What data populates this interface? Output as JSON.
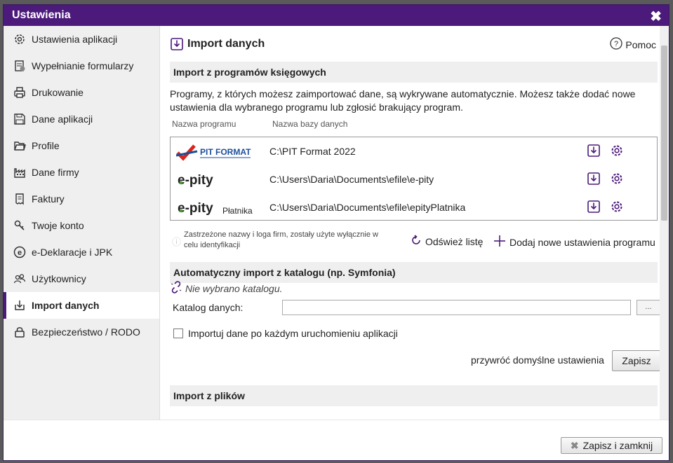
{
  "window": {
    "title": "Ustawienia"
  },
  "sidebar": {
    "items": [
      {
        "label": "Ustawienia aplikacji",
        "icon": "gear-icon"
      },
      {
        "label": "Wypełnianie formularzy",
        "icon": "form-fill-icon"
      },
      {
        "label": "Drukowanie",
        "icon": "printer-icon"
      },
      {
        "label": "Dane aplikacji",
        "icon": "floppy-disk-icon"
      },
      {
        "label": "Profile",
        "icon": "folder-icon"
      },
      {
        "label": "Dane firmy",
        "icon": "factory-icon"
      },
      {
        "label": "Faktury",
        "icon": "invoice-icon"
      },
      {
        "label": "Twoje konto",
        "icon": "key-icon"
      },
      {
        "label": "e-Deklaracje i JPK",
        "icon": "e-declaration-icon"
      },
      {
        "label": "Użytkownicy",
        "icon": "users-icon"
      },
      {
        "label": "Import danych",
        "icon": "import-icon"
      },
      {
        "label": "Bezpieczeństwo / RODO",
        "icon": "lock-icon"
      }
    ],
    "active_index": 10
  },
  "main": {
    "title": "Import danych",
    "help_label": "Pomoc",
    "section1": {
      "title": "Import z programów księgowych",
      "description": "Programy, z których możesz zaimportować dane, są wykrywane automatycznie. Możesz także dodać nowe ustawienia dla wybranego programu lub zgłosić brakujący program.",
      "col_program": "Nazwa programu",
      "col_db": "Nazwa bazy danych",
      "programs": [
        {
          "logo_text": "PIT FORMAT",
          "path": "C:\\PIT Format 2022"
        },
        {
          "logo_text": "e-pity",
          "path": "C:\\Users\\Daria\\Documents\\efile\\e-pity"
        },
        {
          "logo_text": "e-pity",
          "logo_sub": "Płatnika",
          "path": "C:\\Users\\Daria\\Documents\\efile\\epityPlatnika"
        }
      ],
      "note": "Zastrzeżone nazwy i loga firm, zostały użyte wyłącznie w celu identyfikacji",
      "refresh_label": "Odśwież listę",
      "add_label": "Dodaj nowe ustawienia programu"
    },
    "section2": {
      "title": "Automatyczny import z katalogu (np. Symfonia)",
      "no_catalog": "Nie wybrano katalogu.",
      "catalog_label": "Katalog danych:",
      "catalog_value": "",
      "browse_label": "...",
      "checkbox_label": "Importuj dane po każdym uruchomieniu aplikacji",
      "restore_label": "przywróć domyślne ustawienia",
      "save_label": "Zapisz"
    },
    "section3": {
      "title": "Import z plików"
    }
  },
  "footer": {
    "save_close_label": "Zapisz i zamknij"
  },
  "colors": {
    "accent": "#4b1a7a",
    "pit_red": "#d9261c",
    "pit_blue": "#1b4f9c",
    "epity_green": "#4a9b2f"
  }
}
